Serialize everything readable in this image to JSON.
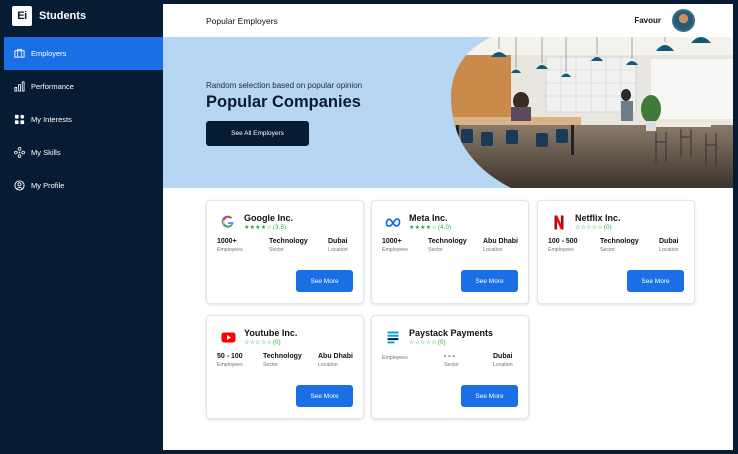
{
  "brand": {
    "logo_text": "Ei",
    "name": "Students"
  },
  "sidebar": {
    "items": [
      {
        "label": "Employers",
        "icon": "briefcase-icon",
        "active": true
      },
      {
        "label": "Performance",
        "icon": "bar-chart-icon"
      },
      {
        "label": "My Interests",
        "icon": "grid-icon"
      },
      {
        "label": "My Skills",
        "icon": "skills-icon"
      },
      {
        "label": "My Profile",
        "icon": "user-circle-icon"
      }
    ]
  },
  "header": {
    "title": "Popular Employers",
    "user_name": "Favour"
  },
  "hero": {
    "subtitle": "Random selection based on popular opinion",
    "title": "Popular Companies",
    "button_label": "See All Employers"
  },
  "companies": [
    {
      "name": "Google Inc.",
      "logo": "google-logo",
      "stars": "★★★★☆",
      "rating": "(3.5)",
      "stats": [
        {
          "value": "1000+",
          "label": "Employees"
        },
        {
          "value": "Technology",
          "label": "Sector"
        },
        {
          "value": "Dubai",
          "label": "Location"
        }
      ],
      "button_label": "See More"
    },
    {
      "name": "Meta Inc.",
      "logo": "meta-logo",
      "stars": "★★★★☆",
      "rating": "(4.0)",
      "stats": [
        {
          "value": "1000+",
          "label": "Employees"
        },
        {
          "value": "Technology",
          "label": "Sector"
        },
        {
          "value": "Abu Dhabi",
          "label": "Location"
        }
      ],
      "button_label": "See More"
    },
    {
      "name": "Netflix Inc.",
      "logo": "netflix-logo",
      "stars": "☆☆☆☆☆",
      "rating": "(0)",
      "stats": [
        {
          "value": "100 - 500",
          "label": "Employees"
        },
        {
          "value": "Technology",
          "label": "Sector"
        },
        {
          "value": "Dubai",
          "label": "Location"
        }
      ],
      "button_label": "See More"
    },
    {
      "name": "Youtube Inc.",
      "logo": "youtube-logo",
      "stars": "☆☆☆☆☆",
      "rating": "(0)",
      "stats": [
        {
          "value": "50 - 100",
          "label": "Employees"
        },
        {
          "value": "Technology",
          "label": "Sector"
        },
        {
          "value": "Abu Dhabi",
          "label": "Location"
        }
      ],
      "button_label": "See More"
    },
    {
      "name": "Paystack Payments",
      "logo": "paystack-logo",
      "stars": "☆☆☆☆☆",
      "rating": "(0)",
      "stats": [
        {
          "value": "",
          "label": "Employees"
        },
        {
          "value": "- - -",
          "label": "Sector"
        },
        {
          "value": "Dubai",
          "label": "Location"
        }
      ],
      "button_label": "See More"
    }
  ],
  "colors": {
    "sidebar": "#061c33",
    "accent": "#1a6fe6",
    "hero_bg": "#b7d6f3",
    "star": "#1fa935"
  }
}
